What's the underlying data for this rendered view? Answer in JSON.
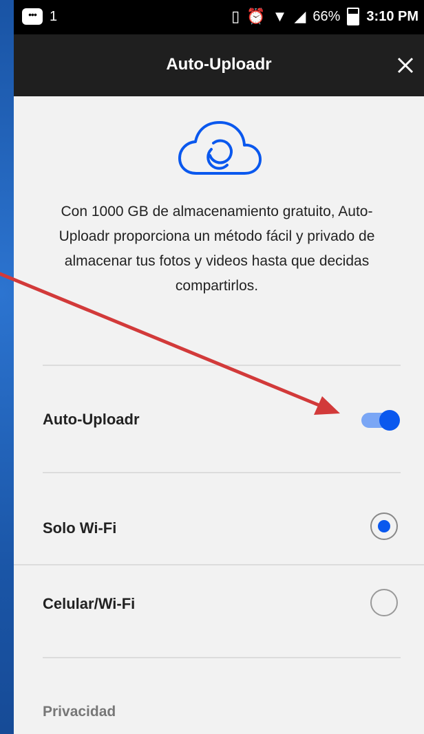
{
  "status_bar": {
    "notification_count": "1",
    "icons": [
      "message-icon",
      "vibrate-icon",
      "alarm-icon",
      "wifi-icon",
      "signal-icon"
    ],
    "battery": "66%",
    "time": "3:10 PM"
  },
  "header": {
    "title": "Auto-Uploadr",
    "close_icon": "close-icon"
  },
  "hero": {
    "icon": "cloud-sync-icon",
    "description": "Con 1000 GB de almacenamiento gratuito, Auto-Uploadr proporciona un método fácil y privado de almacenar tus fotos y videos hasta que decidas compartirlos."
  },
  "settings": {
    "auto_uploadr": {
      "label": "Auto-Uploadr",
      "enabled": true
    },
    "network_options": [
      {
        "label": "Solo Wi-Fi",
        "selected": true
      },
      {
        "label": "Celular/Wi-Fi",
        "selected": false
      }
    ],
    "privacy_section": "Privacidad"
  },
  "colors": {
    "accent": "#0a58ee",
    "header_bg": "#1f1f1f",
    "page_bg": "#f2f2f2",
    "annotation_arrow": "#d23a3a"
  }
}
